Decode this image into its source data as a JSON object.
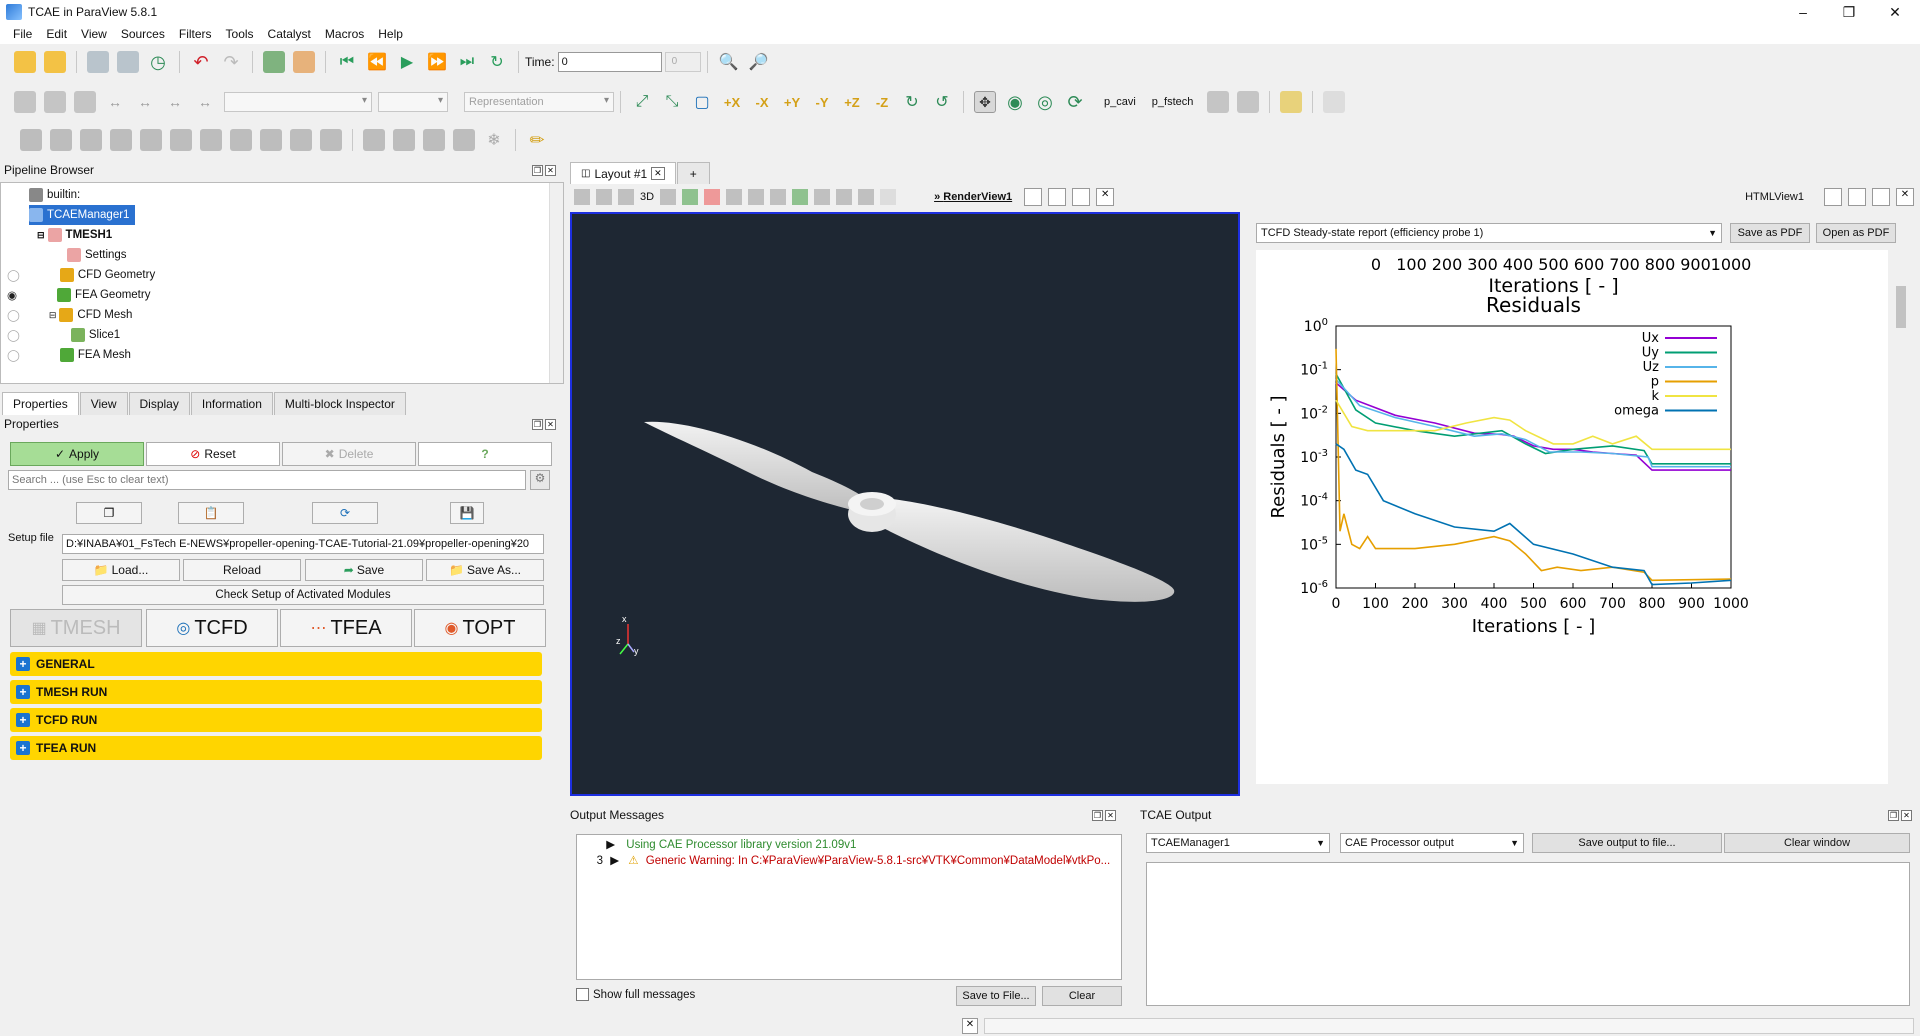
{
  "window": {
    "title": "TCAE in ParaView 5.8.1"
  },
  "menu": [
    "File",
    "Edit",
    "View",
    "Sources",
    "Filters",
    "Tools",
    "Catalyst",
    "Macros",
    "Help"
  ],
  "toolbar": {
    "time_label": "Time:",
    "time_value": "0",
    "time_index": "0",
    "representation_placeholder": "Representation",
    "p_cavi": "p_cavi",
    "p_fstech": "p_fstech"
  },
  "pipeline": {
    "title": "Pipeline Browser",
    "items": [
      "builtin:",
      "TCAEManager1",
      "TMESH1",
      "Settings",
      "CFD Geometry",
      "FEA Geometry",
      "CFD Mesh",
      "Slice1",
      "FEA Mesh"
    ]
  },
  "prop_tabs": [
    "Properties",
    "View",
    "Display",
    "Information",
    "Multi-block Inspector"
  ],
  "properties": {
    "title": "Properties",
    "apply": "Apply",
    "reset": "Reset",
    "delete": "Delete",
    "help": "?",
    "search_placeholder": "Search ... (use Esc to clear text)",
    "setup_label": "Setup file",
    "setup_value": "D:¥INABA¥01_FsTech E-NEWS¥propeller-opening-TCAE-Tutorial-21.09¥propeller-opening¥20",
    "load": "Load...",
    "reload": "Reload",
    "save": "Save",
    "save_as": "Save As...",
    "check_setup": "Check Setup of Activated Modules",
    "modules": [
      "TMESH",
      "TCFD",
      "TFEA",
      "TOPT"
    ],
    "sections": [
      "GENERAL",
      "TMESH RUN",
      "TCFD RUN",
      "TFEA RUN"
    ]
  },
  "layout": {
    "tab": "Layout #1",
    "add": "+",
    "render_view": "RenderView1",
    "view_3d": "3D",
    "html_view": "HTMLView1"
  },
  "html_panel": {
    "report_select": "TCFD Steady-state report (efficiency probe 1)",
    "save_pdf": "Save as PDF",
    "open_pdf": "Open as PDF"
  },
  "chart_data": [
    {
      "type": "line",
      "xlabel": "Iterations [ - ]",
      "xticks": [
        "0",
        "100",
        "200",
        "300",
        "400",
        "500",
        "600",
        "700",
        "800",
        "900",
        "1000"
      ]
    },
    {
      "type": "line",
      "title": "Residuals",
      "xlabel": "Iterations [ - ]",
      "ylabel": "Residuals [ - ]",
      "log_y": true,
      "xlim": [
        0,
        1000
      ],
      "ylim_exp": [
        -6,
        0
      ],
      "xticks": [
        "0",
        "100",
        "200",
        "300",
        "400",
        "500",
        "600",
        "700",
        "800",
        "900",
        "1000"
      ],
      "yticks": [
        {
          "base": "10",
          "exp": "0"
        },
        {
          "base": "10",
          "exp": "-1"
        },
        {
          "base": "10",
          "exp": "-2"
        },
        {
          "base": "10",
          "exp": "-3"
        },
        {
          "base": "10",
          "exp": "-4"
        },
        {
          "base": "10",
          "exp": "-5"
        },
        {
          "base": "10",
          "exp": "-6"
        }
      ],
      "legend_position": "top-right",
      "series": [
        {
          "name": "Ux",
          "color": "#9400d3",
          "points": [
            [
              0,
              0.05
            ],
            [
              50,
              0.02
            ],
            [
              150,
              0.009
            ],
            [
              250,
              0.006
            ],
            [
              350,
              0.0035
            ],
            [
              420,
              0.0033
            ],
            [
              450,
              0.003
            ],
            [
              500,
              0.0018
            ],
            [
              550,
              0.0015
            ],
            [
              600,
              0.0015
            ],
            [
              650,
              0.0013
            ],
            [
              700,
              0.0012
            ],
            [
              760,
              0.0011
            ],
            [
              800,
              0.0005
            ],
            [
              1000,
              0.0005
            ]
          ]
        },
        {
          "name": "Uy",
          "color": "#009e73",
          "points": [
            [
              0,
              0.08
            ],
            [
              50,
              0.012
            ],
            [
              100,
              0.006
            ],
            [
              200,
              0.004
            ],
            [
              300,
              0.003
            ],
            [
              420,
              0.004
            ],
            [
              480,
              0.002
            ],
            [
              530,
              0.0012
            ],
            [
              600,
              0.0015
            ],
            [
              700,
              0.0018
            ],
            [
              780,
              0.0014
            ],
            [
              800,
              0.0007
            ],
            [
              1000,
              0.0007
            ]
          ]
        },
        {
          "name": "Uz",
          "color": "#56b4e9",
          "points": [
            [
              0,
              0.06
            ],
            [
              60,
              0.015
            ],
            [
              150,
              0.008
            ],
            [
              250,
              0.005
            ],
            [
              350,
              0.003
            ],
            [
              420,
              0.0034
            ],
            [
              480,
              0.0025
            ],
            [
              540,
              0.0013
            ],
            [
              620,
              0.0013
            ],
            [
              700,
              0.0012
            ],
            [
              790,
              0.001
            ],
            [
              800,
              0.0006
            ],
            [
              1000,
              0.0006
            ]
          ]
        },
        {
          "name": "p",
          "color": "#e69f00",
          "points": [
            [
              0,
              0.3
            ],
            [
              10,
              2e-05
            ],
            [
              20,
              5e-05
            ],
            [
              40,
              1e-05
            ],
            [
              60,
              8e-06
            ],
            [
              80,
              1.5e-05
            ],
            [
              100,
              8e-06
            ],
            [
              200,
              8e-06
            ],
            [
              300,
              1e-05
            ],
            [
              400,
              1.5e-05
            ],
            [
              440,
              1.2e-05
            ],
            [
              480,
              6e-06
            ],
            [
              520,
              2.5e-06
            ],
            [
              560,
              3e-06
            ],
            [
              620,
              2.5e-06
            ],
            [
              700,
              3e-06
            ],
            [
              780,
              2.3e-06
            ],
            [
              800,
              1.5e-06
            ],
            [
              1000,
              1.6e-06
            ]
          ]
        },
        {
          "name": "k",
          "color": "#f0e442",
          "points": [
            [
              0,
              0.02
            ],
            [
              40,
              0.005
            ],
            [
              80,
              0.004
            ],
            [
              150,
              0.004
            ],
            [
              250,
              0.004
            ],
            [
              330,
              0.006
            ],
            [
              400,
              0.008
            ],
            [
              440,
              0.007
            ],
            [
              480,
              0.004
            ],
            [
              550,
              0.002
            ],
            [
              600,
              0.002
            ],
            [
              650,
              0.003
            ],
            [
              700,
              0.002
            ],
            [
              760,
              0.003
            ],
            [
              800,
              0.0015
            ],
            [
              1000,
              0.0015
            ]
          ]
        },
        {
          "name": "omega",
          "color": "#0072b2",
          "points": [
            [
              0,
              0.002
            ],
            [
              20,
              0.0015
            ],
            [
              50,
              0.0005
            ],
            [
              80,
              0.0004
            ],
            [
              120,
              0.0001
            ],
            [
              200,
              5e-05
            ],
            [
              300,
              2.5e-05
            ],
            [
              400,
              2e-05
            ],
            [
              440,
              3e-05
            ],
            [
              500,
              1e-05
            ],
            [
              600,
              6e-06
            ],
            [
              700,
              3e-06
            ],
            [
              780,
              2.5e-06
            ],
            [
              800,
              1.2e-06
            ],
            [
              900,
              1.3e-06
            ],
            [
              1000,
              1.5e-06
            ]
          ]
        }
      ]
    }
  ],
  "output_messages": {
    "title": "Output Messages",
    "lines": [
      {
        "count": "",
        "text": "Using CAE Processor library version 21.09v1",
        "color": "#2e8b2e"
      },
      {
        "count": "3",
        "text": "Generic Warning: In C:¥ParaView¥ParaView-5.8.1-src¥VTK¥Common¥DataModel¥vtkPo...",
        "color": "#c00000"
      }
    ],
    "show_full": "Show full messages",
    "save_file": "Save to File...",
    "clear": "Clear"
  },
  "tcae_output": {
    "title": "TCAE Output",
    "manager": "TCAEManager1",
    "source": "CAE Processor output",
    "save_output": "Save output to file...",
    "clear_window": "Clear window"
  },
  "colors": {
    "accent_yellow": "#ffd500",
    "render_bg": "#1e2733",
    "selection_blue": "#1d2fe0"
  }
}
